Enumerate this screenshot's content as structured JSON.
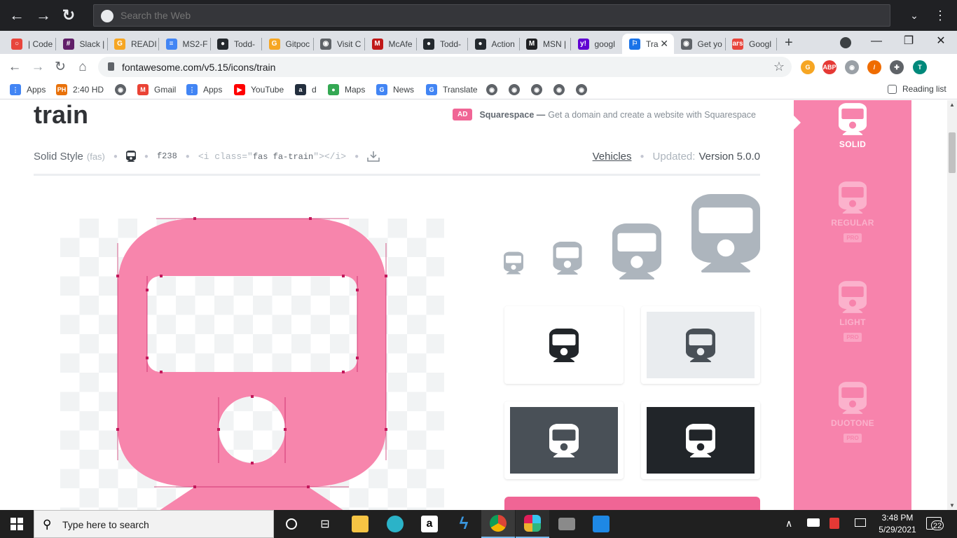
{
  "top_bar": {
    "search_placeholder": "Search the Web"
  },
  "tabs": [
    {
      "label": "| Code",
      "color": "#e8453c",
      "glyph": "○"
    },
    {
      "label": "Slack |",
      "color": "#611f69",
      "glyph": "#"
    },
    {
      "label": "READI",
      "color": "#f6a623",
      "glyph": "G"
    },
    {
      "label": "MS2-F",
      "color": "#4285f4",
      "glyph": "≡"
    },
    {
      "label": "Todd-",
      "color": "#24292e",
      "glyph": "●"
    },
    {
      "label": "Gitpoc",
      "color": "#f6a623",
      "glyph": "G"
    },
    {
      "label": "Visit C",
      "color": "#5f6368",
      "glyph": "◉"
    },
    {
      "label": "McAfe",
      "color": "#c01818",
      "glyph": "M"
    },
    {
      "label": "Todd-",
      "color": "#24292e",
      "glyph": "●"
    },
    {
      "label": "Action",
      "color": "#24292e",
      "glyph": "●"
    },
    {
      "label": "MSN |",
      "color": "#202124",
      "glyph": "M"
    },
    {
      "label": "googl",
      "color": "#6001d2",
      "glyph": "y!"
    },
    {
      "label": "Tra",
      "color": "#1a73e8",
      "glyph": "⚐",
      "active": true
    },
    {
      "label": "Get yo",
      "color": "#5f6368",
      "glyph": "◉"
    },
    {
      "label": "Googl",
      "color": "#e8453c",
      "glyph": "ars"
    }
  ],
  "address": {
    "url": "fontawesome.com/v5.15/icons/train"
  },
  "extensions": [
    {
      "name": "g-ext",
      "color": "#f6a623",
      "glyph": "G"
    },
    {
      "name": "abp",
      "color": "#e53935",
      "glyph": "ABP"
    },
    {
      "name": "circle-ext",
      "color": "#9aa0a6",
      "glyph": "◉"
    },
    {
      "name": "carrot-ext",
      "color": "#ef6c00",
      "glyph": "/"
    },
    {
      "name": "puzzle",
      "color": "#5f6368",
      "glyph": "✚"
    },
    {
      "name": "profile",
      "color": "#00897b",
      "glyph": "T"
    }
  ],
  "bookmarks": [
    {
      "label": "Apps",
      "color": "#4285f4",
      "glyph": "⋮"
    },
    {
      "label": "2:40 HD",
      "color": "#e8710a",
      "glyph": "PH"
    },
    {
      "label": "",
      "color": "#5f6368",
      "glyph": "◉"
    },
    {
      "label": "Gmail",
      "color": "#ea4335",
      "glyph": "M"
    },
    {
      "label": "Apps",
      "color": "#4285f4",
      "glyph": "⋮"
    },
    {
      "label": "YouTube",
      "color": "#ff0000",
      "glyph": "▶"
    },
    {
      "label": "d",
      "color": "#232f3e",
      "glyph": "a"
    },
    {
      "label": "Maps",
      "color": "#34a853",
      "glyph": "●"
    },
    {
      "label": "News",
      "color": "#4285f4",
      "glyph": "G"
    },
    {
      "label": "Translate",
      "color": "#4285f4",
      "glyph": "G"
    },
    {
      "label": "",
      "color": "#5f6368",
      "glyph": "◉"
    },
    {
      "label": "",
      "color": "#5f6368",
      "glyph": "◉"
    },
    {
      "label": "",
      "color": "#5f6368",
      "glyph": "◉"
    },
    {
      "label": "",
      "color": "#5f6368",
      "glyph": "◉"
    },
    {
      "label": "",
      "color": "#5f6368",
      "glyph": "◉"
    }
  ],
  "reading_list": "Reading list",
  "icon_page": {
    "title": "train",
    "ad_badge": "AD",
    "ad_brand": "Squarespace —",
    "ad_text": "Get a domain and create a website with Squarespace",
    "style_label": "Solid Style",
    "style_prefix": "(fas)",
    "unicode": "f238",
    "code_open": "<i class=\"",
    "code_class": "fas fa-train",
    "code_close": "\"></i>",
    "category": "Vehicles",
    "updated_label": "Updated:",
    "updated_value": "Version 5.0.0"
  },
  "styles_sidebar": [
    {
      "label": "SOLID",
      "pro": "",
      "active": true
    },
    {
      "label": "REGULAR",
      "pro": "PRO",
      "active": false
    },
    {
      "label": "LIGHT",
      "pro": "PRO",
      "active": false
    },
    {
      "label": "DUOTONE",
      "pro": "PRO",
      "active": false
    }
  ],
  "colors": {
    "accent": "#f783ac",
    "pink_shape": "#f785ac",
    "gray_icon": "#adb5bd",
    "dark": "#212529"
  },
  "taskbar": {
    "search_placeholder": "Type here to search",
    "time": "3:48 PM",
    "date": "5/29/2021",
    "notifications": "22"
  }
}
